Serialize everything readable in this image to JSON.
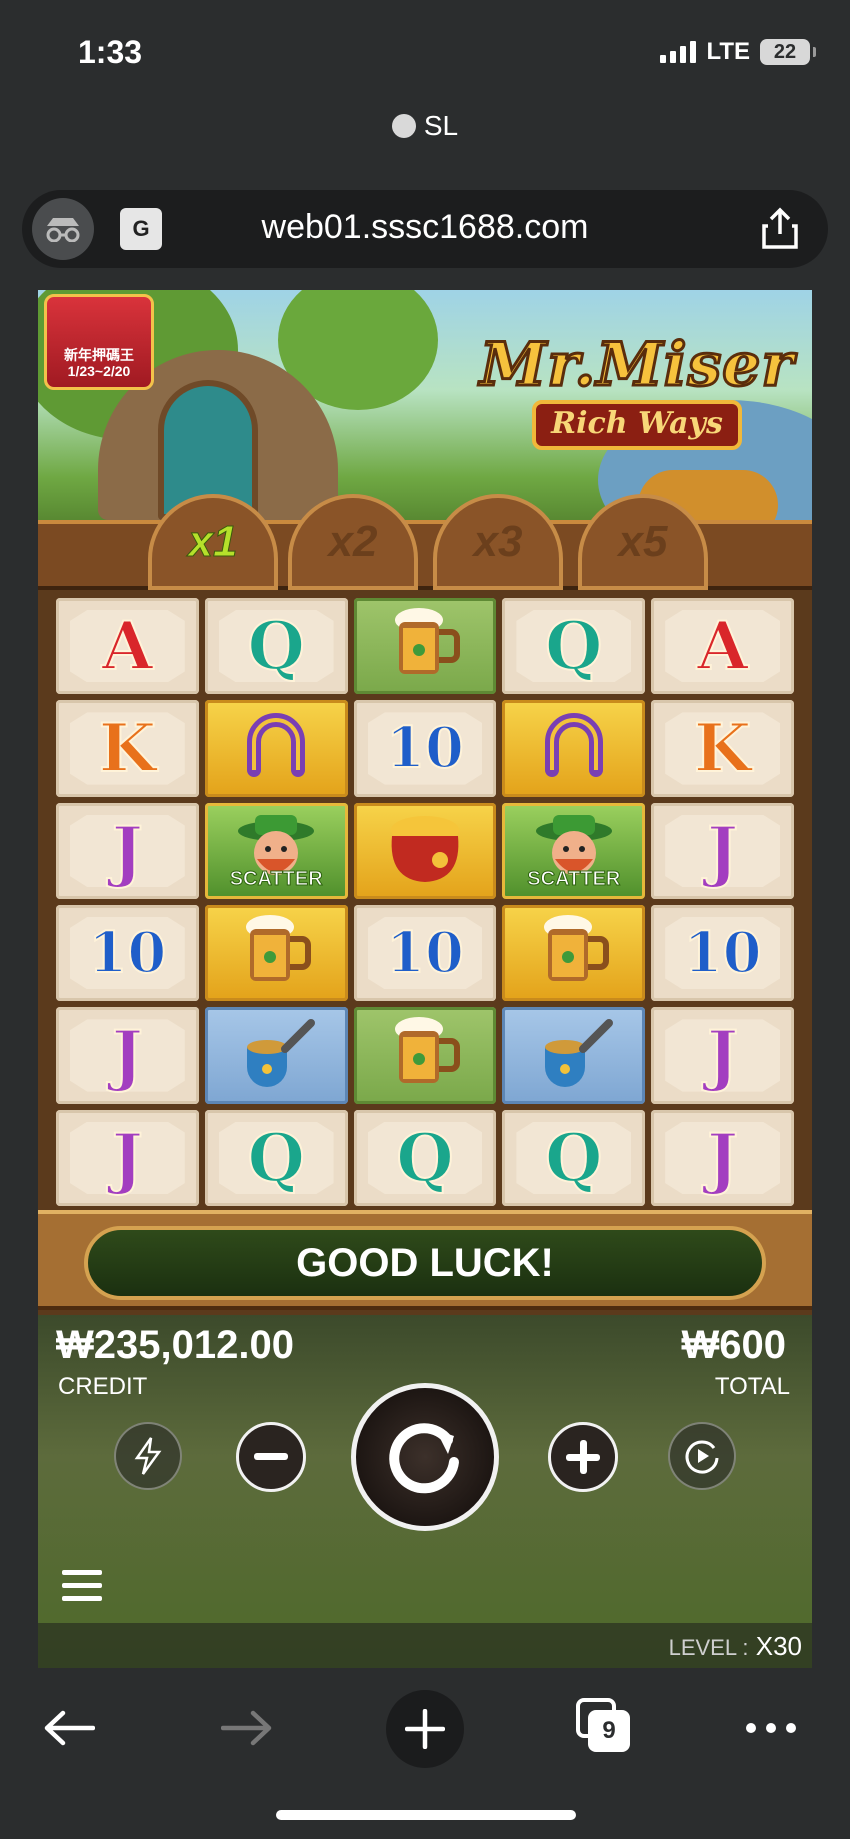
{
  "status": {
    "time": "1:33",
    "network": "LTE",
    "battery": "22"
  },
  "browser": {
    "site_label": "SL",
    "url": "web01.sssc1688.com",
    "tabs_count": "9"
  },
  "game": {
    "badge_text": "新年押碼王\n1/23~2/20",
    "logo_title": "Mr.Miser",
    "logo_subtitle": "Rich Ways",
    "multipliers": [
      {
        "label": "x1",
        "active": true
      },
      {
        "label": "x2",
        "active": false
      },
      {
        "label": "x3",
        "active": false
      },
      {
        "label": "x5",
        "active": false
      }
    ],
    "grid": [
      [
        "A",
        "Q",
        "beer",
        "Q",
        "A"
      ],
      [
        "K",
        "horseshoe",
        "10",
        "horseshoe",
        "K"
      ],
      [
        "J",
        "scatter",
        "pot",
        "scatter",
        "J"
      ],
      [
        "10",
        "beer-gold",
        "10",
        "beer-gold",
        "10"
      ],
      [
        "J",
        "pipe",
        "beer",
        "pipe",
        "J"
      ],
      [
        "J",
        "Q",
        "Q",
        "Q",
        "J"
      ]
    ],
    "scatter_label": "SCATTER",
    "message": "GOOD LUCK!",
    "credit": {
      "value": "₩235,012.00",
      "label": "CREDIT"
    },
    "total": {
      "value": "₩600",
      "label": "TOTAL"
    },
    "level": {
      "label": "LEVEL :",
      "value": "X30"
    }
  }
}
